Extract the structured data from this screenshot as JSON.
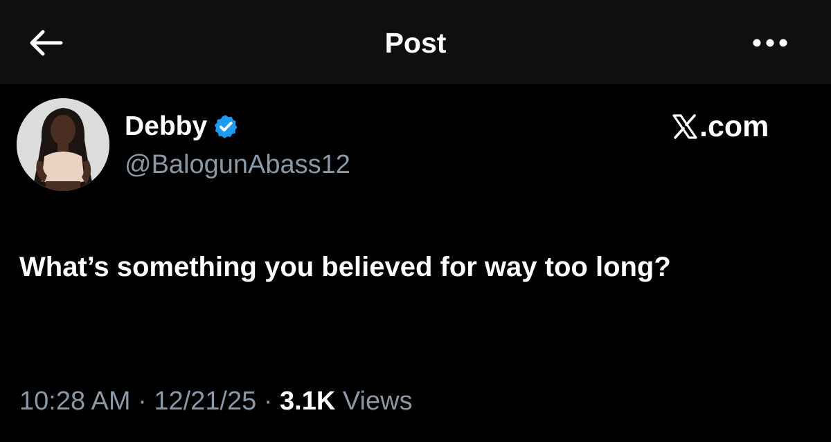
{
  "header": {
    "title": "Post",
    "back_icon": "arrow-left-icon",
    "more_icon": "more-horizontal-icon"
  },
  "author": {
    "display_name": "Debby",
    "handle": "@BalogunAbass12",
    "verified": true,
    "verified_color": "#1d9bf0"
  },
  "watermark": {
    "text": ".com",
    "logo_icon": "x-logo-icon"
  },
  "post": {
    "text": "What’s something you believed for way too long?"
  },
  "meta": {
    "time": "10:28 AM",
    "separator": " · ",
    "date": "12/21/25",
    "views_count": "3.1K",
    "views_label": " Views"
  },
  "colors": {
    "background": "#000000",
    "header_background": "#0f0f0f",
    "primary_text": "#ffffff",
    "secondary_text": "#8b98a5",
    "accent": "#1d9bf0"
  }
}
